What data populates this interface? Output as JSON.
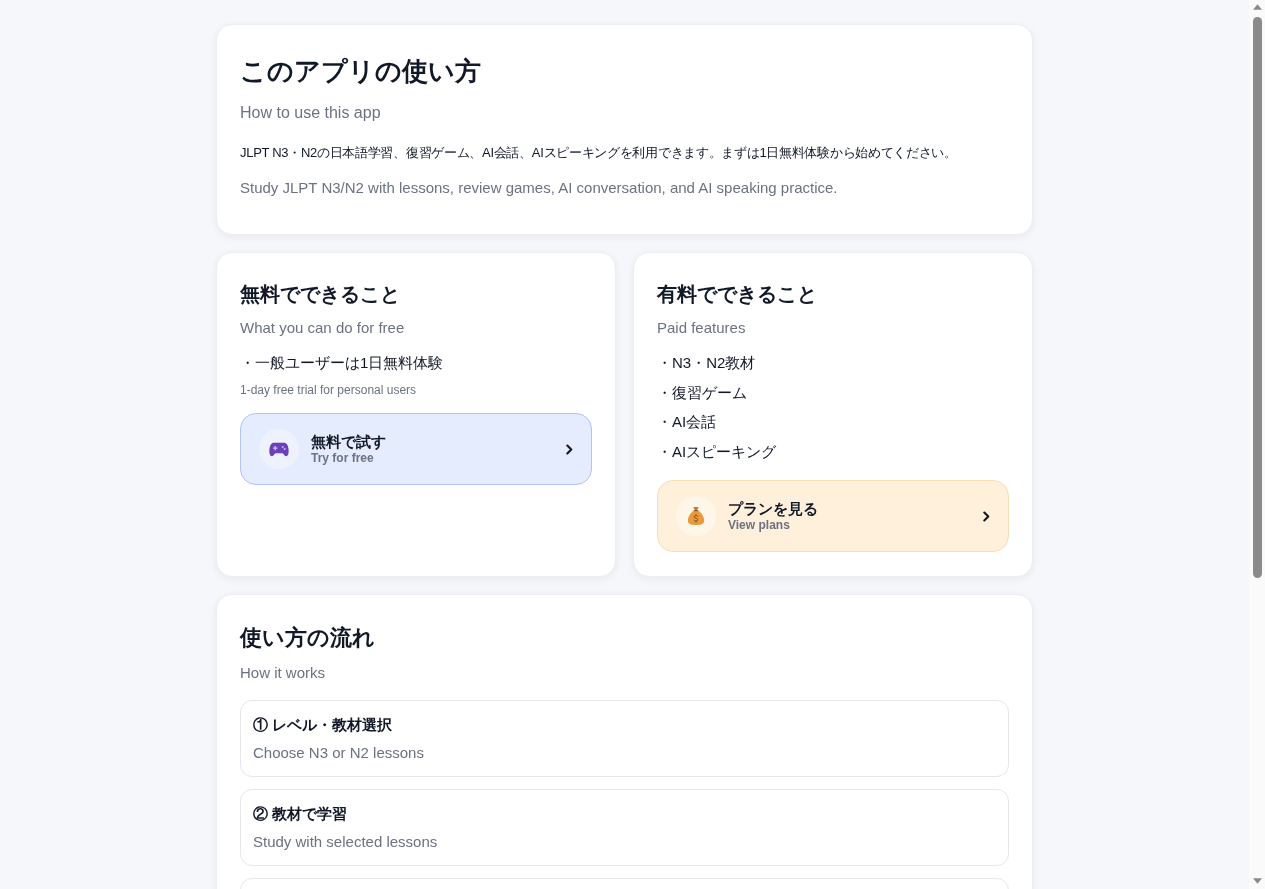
{
  "intro": {
    "title": "このアプリの使い方",
    "subtitle": "How to use this app",
    "description_ja": "JLPT N3・N2の日本語学習、復習ゲーム、AI会話、AIスピーキングを利用できます。まずは1日無料体験から始めてください。",
    "description_en": "Study JLPT N3/N2 with lessons, review games, AI conversation, and AI speaking practice."
  },
  "plans": [
    {
      "kind": "free",
      "title": "無料でできること",
      "subtitle": "What you can do for free",
      "items": [
        {
          "text": "・一般ユーザーは1日無料体験",
          "note": "1-day free trial for personal users"
        }
      ],
      "button": {
        "label": "無料で試す",
        "sublabel": "Try for free"
      }
    },
    {
      "kind": "paid",
      "title": "有料でできること",
      "subtitle": "Paid features",
      "items": [
        {
          "text": "・N3・N2教材"
        },
        {
          "text": "・復習ゲーム"
        },
        {
          "text": "・AI会話"
        },
        {
          "text": "・AIスピーキング"
        }
      ],
      "button": {
        "label": "プランを見る",
        "sublabel": "View plans"
      }
    }
  ],
  "flow": {
    "title": "使い方の流れ",
    "subtitle": "How it works",
    "steps": [
      {
        "title": "① レベル・教材選択",
        "subtitle": "Choose N3 or N2 lessons"
      },
      {
        "title": "② 教材で学習",
        "subtitle": "Study with selected lessons"
      }
    ]
  }
}
